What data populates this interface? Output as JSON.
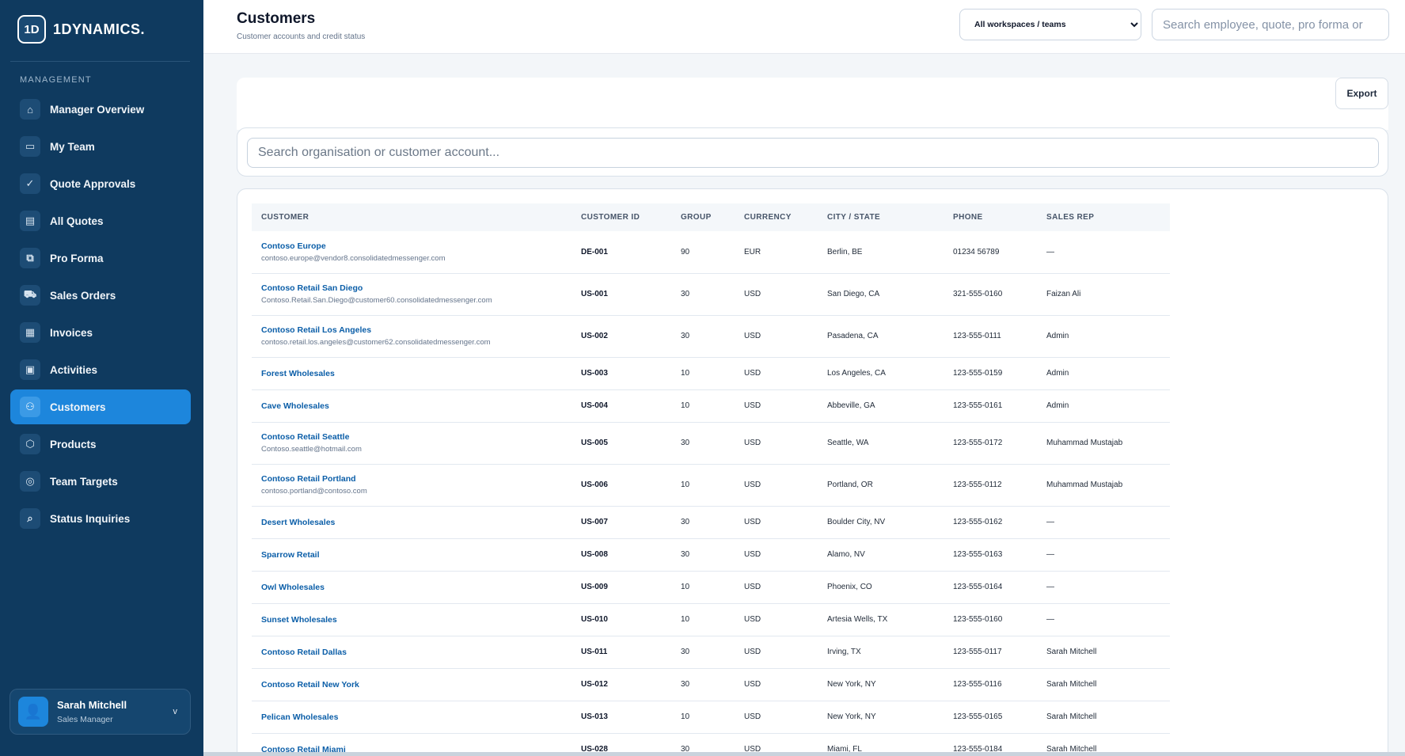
{
  "app": {
    "brand_mark": "1D",
    "brand_name": "1DYNAMICS."
  },
  "sidebar": {
    "section_label": "MANAGEMENT",
    "items": [
      {
        "label": "Manager Overview",
        "icon": "⌂",
        "icon_name": "home-icon",
        "active": false
      },
      {
        "label": "My Team",
        "icon": "▭",
        "icon_name": "briefcase-icon",
        "active": false
      },
      {
        "label": "Quote Approvals",
        "icon": "✓",
        "icon_name": "check-icon",
        "active": false
      },
      {
        "label": "All Quotes",
        "icon": "▤",
        "icon_name": "document-icon",
        "active": false
      },
      {
        "label": "Pro Forma",
        "icon": "⧉",
        "icon_name": "copy-icon",
        "active": false
      },
      {
        "label": "Sales Orders",
        "icon": "⛟",
        "icon_name": "cart-icon",
        "active": false
      },
      {
        "label": "Invoices",
        "icon": "▦",
        "icon_name": "receipt-icon",
        "active": false
      },
      {
        "label": "Activities",
        "icon": "▣",
        "icon_name": "calendar-icon",
        "active": false
      },
      {
        "label": "Customers",
        "icon": "⚇",
        "icon_name": "users-icon",
        "active": true
      },
      {
        "label": "Products",
        "icon": "⬡",
        "icon_name": "box-icon",
        "active": false
      },
      {
        "label": "Team Targets",
        "icon": "◎",
        "icon_name": "target-icon",
        "active": false
      },
      {
        "label": "Status Inquiries",
        "icon": "⌕",
        "icon_name": "search-icon",
        "active": false
      }
    ],
    "user": {
      "name": "Sarah Mitchell",
      "role": "Sales Manager",
      "caret": "v"
    }
  },
  "header": {
    "title": "Customers",
    "subtitle": "Customer accounts and credit status",
    "workspace_select": {
      "selected": "All workspaces / teams"
    },
    "search_placeholder": "Search employee, quote, pro forma or"
  },
  "toolbar": {
    "export_label": "Export"
  },
  "customer_search": {
    "placeholder": "Search organisation or customer account..."
  },
  "table": {
    "columns": [
      "CUSTOMER",
      "CUSTOMER ID",
      "GROUP",
      "CURRENCY",
      "CITY / STATE",
      "PHONE",
      "SALES REP"
    ],
    "rows": [
      {
        "name": "Contoso Europe",
        "email": "contoso.europe@vendor8.consolidatedmessenger.com",
        "id": "DE-001",
        "group": "90",
        "currency": "EUR",
        "city": "Berlin, BE",
        "phone": "01234 56789",
        "rep": "—"
      },
      {
        "name": "Contoso Retail San Diego",
        "email": "Contoso.Retail.San.Diego@customer60.consolidatedmessenger.com",
        "id": "US-001",
        "group": "30",
        "currency": "USD",
        "city": "San Diego, CA",
        "phone": "321-555-0160",
        "rep": "Faizan Ali"
      },
      {
        "name": "Contoso Retail Los Angeles",
        "email": "contoso.retail.los.angeles@customer62.consolidatedmessenger.com",
        "id": "US-002",
        "group": "30",
        "currency": "USD",
        "city": "Pasadena, CA",
        "phone": "123-555-0111",
        "rep": "Admin"
      },
      {
        "name": "Forest Wholesales",
        "email": "",
        "id": "US-003",
        "group": "10",
        "currency": "USD",
        "city": "Los Angeles, CA",
        "phone": "123-555-0159",
        "rep": "Admin"
      },
      {
        "name": "Cave Wholesales",
        "email": "",
        "id": "US-004",
        "group": "10",
        "currency": "USD",
        "city": "Abbeville, GA",
        "phone": "123-555-0161",
        "rep": "Admin"
      },
      {
        "name": "Contoso Retail Seattle",
        "email": "Contoso.seattle@hotmail.com",
        "id": "US-005",
        "group": "30",
        "currency": "USD",
        "city": "Seattle, WA",
        "phone": "123-555-0172",
        "rep": "Muhammad Mustajab"
      },
      {
        "name": "Contoso Retail Portland",
        "email": "contoso.portland@contoso.com",
        "id": "US-006",
        "group": "10",
        "currency": "USD",
        "city": "Portland, OR",
        "phone": "123-555-0112",
        "rep": "Muhammad Mustajab"
      },
      {
        "name": "Desert Wholesales",
        "email": "",
        "id": "US-007",
        "group": "30",
        "currency": "USD",
        "city": "Boulder City, NV",
        "phone": "123-555-0162",
        "rep": "—"
      },
      {
        "name": "Sparrow Retail",
        "email": "",
        "id": "US-008",
        "group": "30",
        "currency": "USD",
        "city": "Alamo, NV",
        "phone": "123-555-0163",
        "rep": "—"
      },
      {
        "name": "Owl Wholesales",
        "email": "",
        "id": "US-009",
        "group": "10",
        "currency": "USD",
        "city": "Phoenix, CO",
        "phone": "123-555-0164",
        "rep": "—"
      },
      {
        "name": "Sunset Wholesales",
        "email": "",
        "id": "US-010",
        "group": "10",
        "currency": "USD",
        "city": "Artesia Wells, TX",
        "phone": "123-555-0160",
        "rep": "—"
      },
      {
        "name": "Contoso Retail Dallas",
        "email": "",
        "id": "US-011",
        "group": "30",
        "currency": "USD",
        "city": "Irving, TX",
        "phone": "123-555-0117",
        "rep": "Sarah Mitchell"
      },
      {
        "name": "Contoso Retail New York",
        "email": "",
        "id": "US-012",
        "group": "30",
        "currency": "USD",
        "city": "New York, NY",
        "phone": "123-555-0116",
        "rep": "Sarah Mitchell"
      },
      {
        "name": "Pelican Wholesales",
        "email": "",
        "id": "US-013",
        "group": "10",
        "currency": "USD",
        "city": "New York, NY",
        "phone": "123-555-0165",
        "rep": "Sarah Mitchell"
      },
      {
        "name": "Contoso Retail Miami",
        "email": "",
        "id": "US-028",
        "group": "30",
        "currency": "USD",
        "city": "Miami, FL",
        "phone": "123-555-0184",
        "rep": "Sarah Mitchell"
      }
    ]
  }
}
